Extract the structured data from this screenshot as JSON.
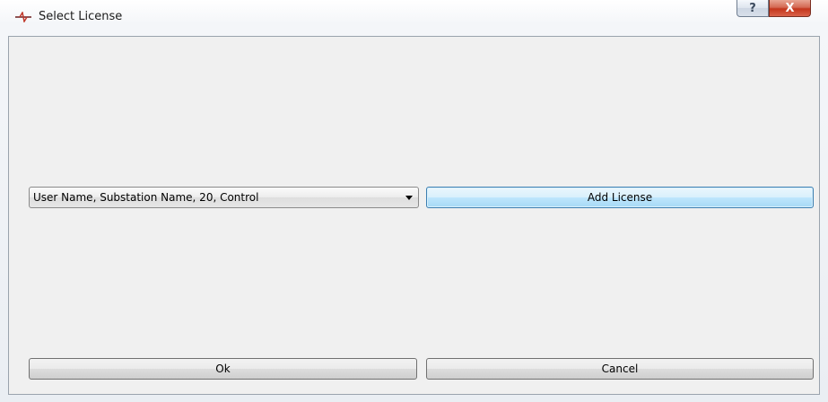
{
  "window": {
    "title": "Select License",
    "app_icon": "transmission-line-icon",
    "help_label": "?",
    "close_label": "X"
  },
  "license_select": {
    "selected_value": "User Name, Substation Name, 20, Control"
  },
  "buttons": {
    "add_license": "Add License",
    "ok": "Ok",
    "cancel": "Cancel"
  },
  "colors": {
    "default_button_border": "#3c7fb1",
    "close_button": "#c4361c"
  }
}
